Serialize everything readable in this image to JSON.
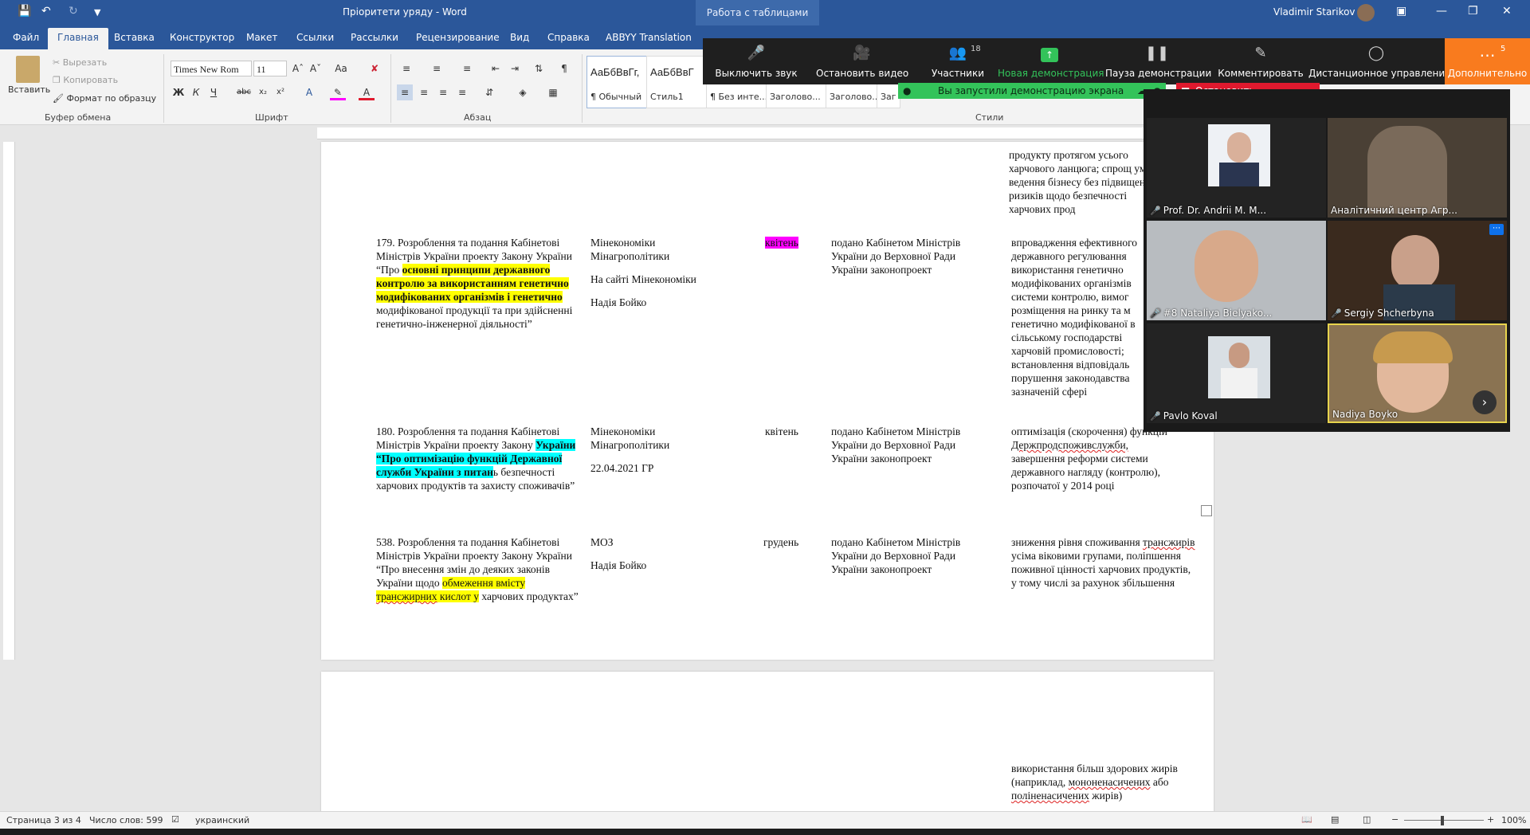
{
  "titlebar": {
    "doc_title": "Пріоритети уряду - Word",
    "context_tab": "Работа с таблицами",
    "user_name": "Vladimir Starikov",
    "save_icon": "save-icon",
    "undo_icon": "undo-icon",
    "redo_icon": "redo-icon"
  },
  "tabs": [
    {
      "label": "Файл"
    },
    {
      "label": "Главная"
    },
    {
      "label": "Вставка"
    },
    {
      "label": "Конструктор"
    },
    {
      "label": "Макет"
    },
    {
      "label": "Ссылки"
    },
    {
      "label": "Рассылки"
    },
    {
      "label": "Рецензирование"
    },
    {
      "label": "Вид"
    },
    {
      "label": "Справка"
    },
    {
      "label": "ABBYY Translation"
    }
  ],
  "ribbon": {
    "paste": "Вставить",
    "cut": "Вырезать",
    "copy": "Копировать",
    "format_painter": "Формат по образцу",
    "group_clipboard": "Буфер обмена",
    "font_name": "Times New Rom",
    "font_size": "11",
    "group_font": "Шрифт",
    "group_paragraph": "Абзац",
    "group_styles": "Стили",
    "styles": [
      {
        "sample": "АаБбВвГг,",
        "name": "¶ Обычный"
      },
      {
        "sample": "АаБбВвГ",
        "name": "Стиль1"
      },
      {
        "sample": "",
        "name": "¶ Без инте..."
      },
      {
        "sample": "",
        "name": "Заголово..."
      },
      {
        "sample": "",
        "name": "Заголово..."
      },
      {
        "sample": "",
        "name": "Заг"
      }
    ]
  },
  "document": {
    "row0": {
      "result": "продукту протягом усього харчового ланцюга; спрощ умов ведення бізнесу без підвищення ризиків щодо безпечності харчових прод"
    },
    "row179": {
      "title_pre": "179. Розроблення та подання Кабінетові Міністрів України проекту Закону України “Про ",
      "title_hl": "основні принципи державного контролю за використанням генетично модифікованих організмів і генетично",
      "title_post": " модифікованої продукції та при здійсненні генетично-інженерної діяльності”",
      "responsible_1": "Мінекономіки",
      "responsible_2": "Мінагрополітики",
      "responsible_3": "На сайті Мінекономіки",
      "responsible_4": "Надія Бойко",
      "term": "квітень",
      "status": "подано Кабінетом Міністрів України до Верховної Ради України законопроект",
      "result": "впровадження ефективного державного регулювання використання генетично модифікованих організмів системи контролю, вимог розміщення на ринку та м генетично модифікованої в сільському господарстві харчовій промисловості; встановлення відповідаль порушення законодавства зазначеній сфері"
    },
    "row180": {
      "title_pre": "180. Розроблення та подання Кабінетові Міністрів України проекту Закону ",
      "title_hl": "України “Про оптимізацію функцій Державної служби України з питан",
      "title_post": "ь безпечності харчових продуктів та захисту споживачів”",
      "responsible_1": "Мінекономіки",
      "responsible_2": "Мінагрополітики",
      "responsible_3": "22.04.2021 ГР",
      "term": "квітень",
      "status": "подано Кабінетом Міністрів України до Верховної Ради України законопроект",
      "result_1": "оптимізація (скорочення) функцій",
      "result_2": "Держпродспоживслужби,",
      "result_3": "завершення реформи системи державного нагляду (контролю), розпочатої у 2014  році"
    },
    "row538": {
      "title_pre": "538. Розроблення та подання Кабінетові Міністрів України проекту Закону України “Про внесення змін до деяких законів України щодо ",
      "title_hl": "обмеження вмісту",
      "title_hl2_a": "транcжирних",
      "title_hl2_b": " кислот у",
      "title_post": " харчових продуктах”",
      "responsible_1": "МОЗ",
      "responsible_2": "Надія Бойко",
      "term": "грудень",
      "status": "подано Кабінетом Міністрів України до Верховної Ради України законопроект",
      "result_pre": "зниження рівня споживання ",
      "result_sq": "трансжирів",
      "result_post": " усіма віковими групами, поліпшення поживної цінності харчових продуктів, у тому числі за рахунок збільшення"
    },
    "page2": {
      "line1": "використання більш здорових жирів",
      "line2_a": "(наприклад, ",
      "line2_sq": "мононенасичених",
      "line2_b": " або",
      "line3_sq": "поліненасичених",
      "line3_b": " жирів)"
    }
  },
  "statusbar": {
    "page": "Страница 3 из 4",
    "words": "Число слов: 599",
    "language": "украинский",
    "zoom": "100%"
  },
  "zoom": {
    "toolbar": [
      {
        "label": "Выключить звук",
        "icon": "microphone-icon"
      },
      {
        "label": "Остановить видео",
        "icon": "camera-icon"
      },
      {
        "label": "Участники",
        "icon": "participants-icon",
        "count": "18"
      },
      {
        "label": "Новая демонстрация",
        "icon": "share-screen-icon"
      },
      {
        "label": "Пауза демонстрации",
        "icon": "pause-icon"
      },
      {
        "label": "Комментировать",
        "icon": "pencil-icon"
      },
      {
        "label": "Дистанционное управление",
        "icon": "mouse-icon"
      }
    ],
    "more_label": "Дополнительно",
    "more_badge": "5",
    "sharing_notice": "Вы запустили демонстрацию экрана",
    "stop_share": "Остановить демонстрацию",
    "participants": [
      {
        "name": "Prof. Dr. Andrii M. M..."
      },
      {
        "name": "Аналітичний центр Агр..."
      },
      {
        "name": "#8 Nataliya Bielyako..."
      },
      {
        "name": "Sergiy Shcherbyna"
      },
      {
        "name": "Pavlo Koval"
      },
      {
        "name": "Nadiya Boyko"
      }
    ]
  },
  "colors": {
    "word_blue": "#2b579a",
    "zoom_green": "#33c35a",
    "zoom_red": "#e0192e",
    "zoom_orange": "#f97b1e",
    "highlight_yellow": "#ffff00",
    "highlight_cyan": "#00ffff",
    "highlight_magenta": "#ff00ff"
  }
}
